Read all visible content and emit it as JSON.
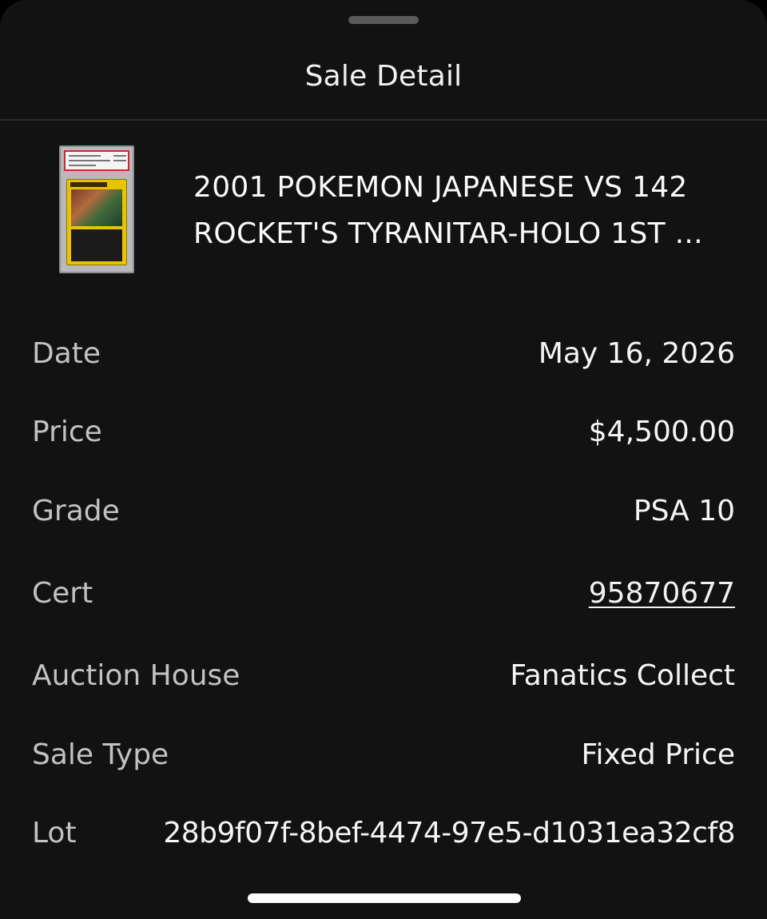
{
  "sheet": {
    "title": "Sale Detail",
    "grabber_icon": "drag-handle"
  },
  "item": {
    "thumbnail_icon": "graded-card-slab",
    "title_line1": "2001 POKEMON JAPANESE VS 142",
    "title_line2": "ROCKET'S TYRANITAR-HOLO 1ST ..."
  },
  "details": [
    {
      "label": "Date",
      "value": "May 16, 2026"
    },
    {
      "label": "Price",
      "value": "$4,500.00"
    },
    {
      "label": "Grade",
      "value": "PSA 10"
    },
    {
      "label": "Cert",
      "value": "95870677"
    },
    {
      "label": "Auction House",
      "value": "Fanatics Collect"
    },
    {
      "label": "Sale Type",
      "value": "Fixed Price"
    },
    {
      "label": "Lot",
      "value": "28b9f07f-8bef-4474-97e5-d1031ea32cf8"
    }
  ],
  "colors": {
    "background": "#121212",
    "text_primary": "#f5f5f5",
    "text_secondary": "#c2c2c2"
  }
}
